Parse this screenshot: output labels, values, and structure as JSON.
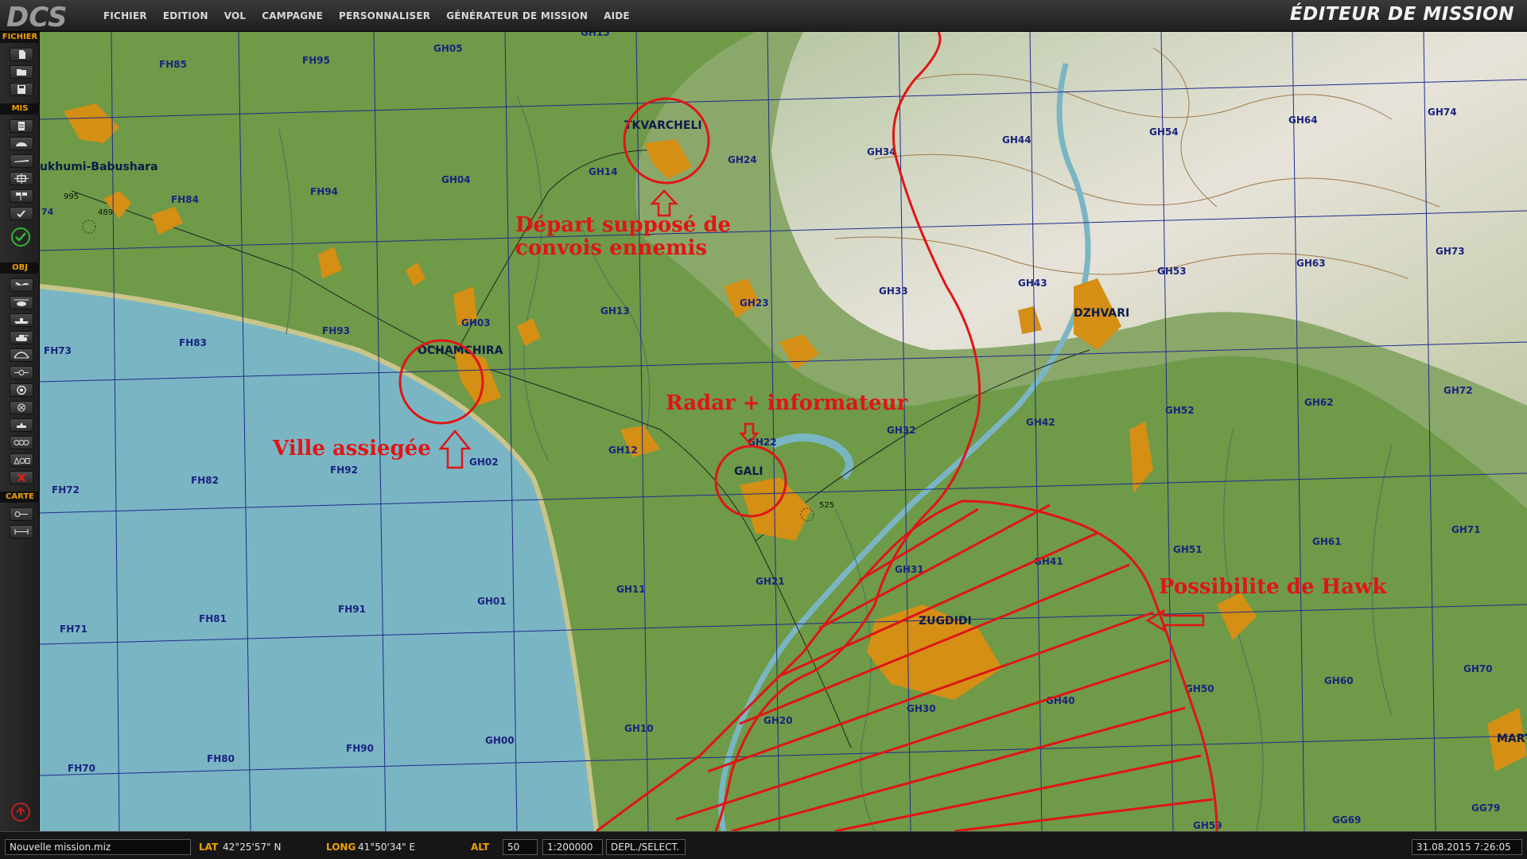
{
  "app": {
    "logo": "DCS",
    "title": "ÉDITEUR DE MISSION"
  },
  "menu": [
    "FICHIER",
    "EDITION",
    "VOL",
    "CAMPAGNE",
    "PERSONNALISER",
    "GÉNÉRATEUR DE MISSION",
    "AIDE"
  ],
  "sidebar": {
    "fichier": "FICHIER",
    "mis": "MIS",
    "obj": "OBJ",
    "carte": "CARTE"
  },
  "grid": {
    "FH85": "FH85",
    "FH95": "FH95",
    "GH05": "GH05",
    "GH15": "GH15",
    "FH84": "FH84",
    "FH94": "FH94",
    "GH04": "GH04",
    "GH14": "GH14",
    "GH24": "GH24",
    "GH34": "GH34",
    "GH44": "GH44",
    "GH54": "GH54",
    "GH64": "GH64",
    "GH74": "GH74",
    "FH73": "FH73",
    "FH83": "FH83",
    "FH93": "FH93",
    "GH03": "GH03",
    "GH13": "GH13",
    "GH23": "GH23",
    "GH33": "GH33",
    "GH43": "GH43",
    "GH53": "GH53",
    "GH63": "GH63",
    "GH73": "GH73",
    "FH72": "FH72",
    "FH82": "FH82",
    "FH92": "FH92",
    "GH02": "GH02",
    "GH12": "GH12",
    "GH22": "GH22",
    "GH32": "GH32",
    "GH42": "GH42",
    "GH52": "GH52",
    "GH62": "GH62",
    "GH72": "GH72",
    "FH71": "FH71",
    "FH81": "FH81",
    "FH91": "FH91",
    "GH01": "GH01",
    "GH11": "GH11",
    "GH21": "GH21",
    "GH31": "GH31",
    "GH41": "GH41",
    "GH51": "GH51",
    "GH61": "GH61",
    "GH71": "GH71",
    "FH70": "FH70",
    "FH80": "FH80",
    "FH90": "FH90",
    "GH00": "GH00",
    "GH10": "GH10",
    "GH20": "GH20",
    "GH30": "GH30",
    "GH40": "GH40",
    "GH50": "GH50",
    "GH60": "GH60",
    "GH70": "GH70",
    "GH59": "GH59",
    "GG69": "GG69",
    "GG79": "GG79"
  },
  "cities": {
    "sukhumi": "ukhumi-Babushara",
    "tkvarcheli": "TKVARCHELI",
    "ochamchira": "OCHAMCHIRA",
    "gali": "GALI",
    "zugdidi": "ZUGDIDI",
    "dzhvari": "DZHVARI",
    "martvili": "MART"
  },
  "elevations": {
    "e1": "995",
    "e2": "489",
    "e3": "525",
    "e4": "74"
  },
  "annotations": {
    "convoy_line1": "Départ supposé de",
    "convoy_line2": "convois ennemis",
    "radar": "Radar + informateur",
    "ville": "Ville assiegée",
    "hawk": "Possibilite de Hawk"
  },
  "status": {
    "mission_file": "Nouvelle mission.miz",
    "lat_label": "LAT",
    "lat_value": "42°25'57\" N",
    "long_label": "LONG",
    "long_value": "41°50'34\" E",
    "alt_label": "ALT",
    "alt_value": "50",
    "scale": "1:200000",
    "mode": "DEPL./SELECT.",
    "datetime": "31.08.2015 7:26:05"
  },
  "colors": {
    "sea": "#7ab5c4",
    "land": "#6f9a47",
    "urban": "#d48f14",
    "grid": "#1f2c8c",
    "annotation": "#e01515",
    "accent": "#f0a000"
  }
}
